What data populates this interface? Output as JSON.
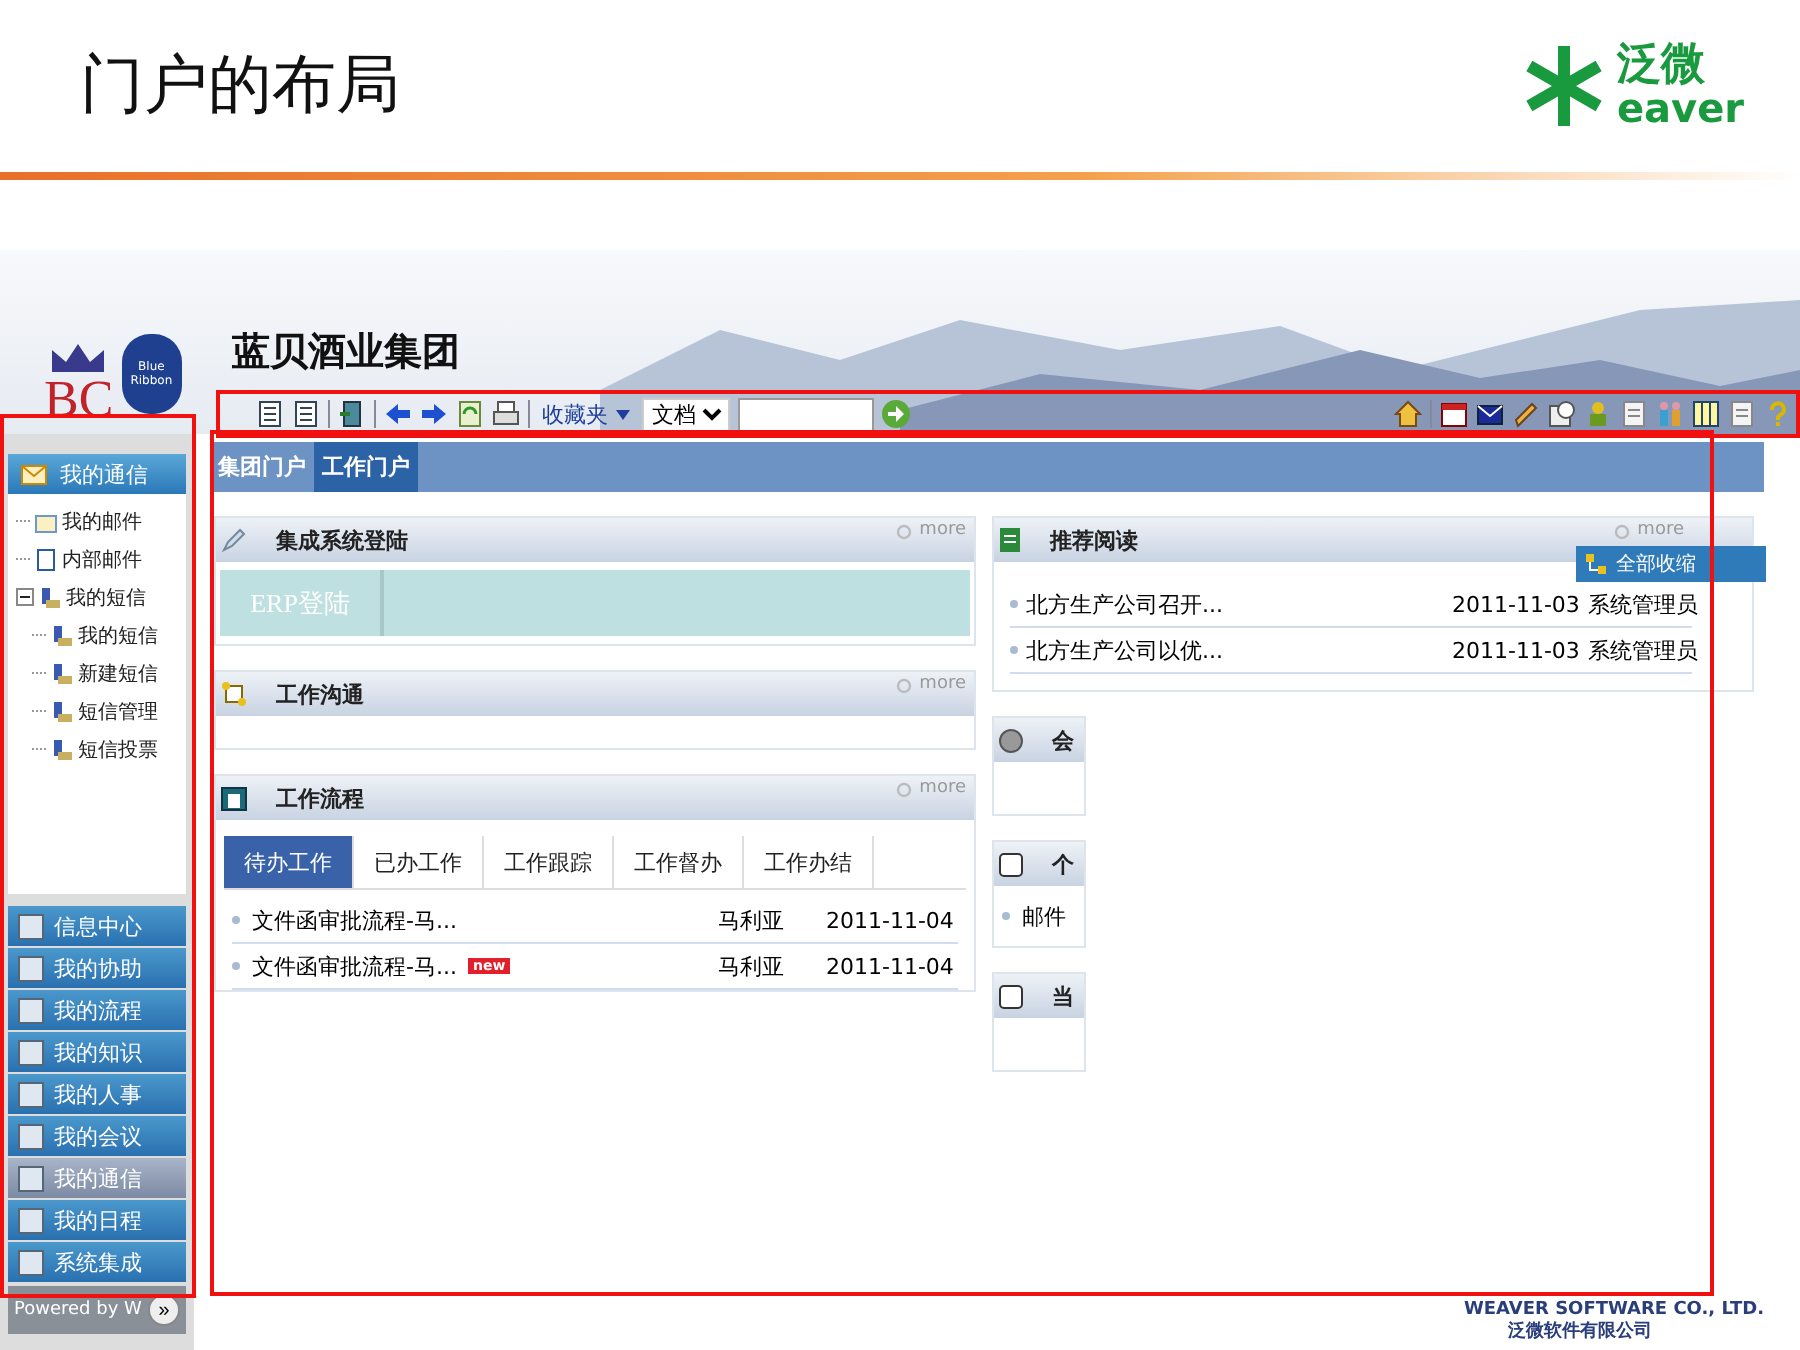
{
  "slide": {
    "title": "门户的布局",
    "logo_mark": "泛微",
    "logo_sub": "eaver"
  },
  "banner": {
    "logos": [
      "BC",
      "Blue Ribbon"
    ],
    "company": "蓝贝酒业集团"
  },
  "toolbar": {
    "favorites": "收藏夹",
    "search_type": "文档"
  },
  "sidebar": {
    "header": "我的通信",
    "tree": [
      {
        "label": "我的邮件"
      },
      {
        "label": "内部邮件"
      },
      {
        "label": "我的短信",
        "expanded": true,
        "children": [
          {
            "label": "我的短信"
          },
          {
            "label": "新建短信"
          },
          {
            "label": "短信管理"
          },
          {
            "label": "短信投票"
          }
        ]
      }
    ],
    "menu": [
      {
        "label": "信息中心",
        "selected": false
      },
      {
        "label": "我的协助",
        "selected": false
      },
      {
        "label": "我的流程",
        "selected": false
      },
      {
        "label": "我的知识",
        "selected": false
      },
      {
        "label": "我的人事",
        "selected": false
      },
      {
        "label": "我的会议",
        "selected": false
      },
      {
        "label": "我的通信",
        "selected": true
      },
      {
        "label": "我的日程",
        "selected": false
      },
      {
        "label": "系统集成",
        "selected": false
      }
    ],
    "footer": "Powered by W",
    "collapse": "»"
  },
  "portal": {
    "tabs": [
      {
        "label": "集团门户",
        "selected": false
      },
      {
        "label": "工作门户",
        "selected": true
      }
    ],
    "left_panels": [
      {
        "kind": "login",
        "title": "集成系统登陆",
        "more": "more",
        "button": "ERP登陆"
      },
      {
        "kind": "empty",
        "title": "工作沟通",
        "more": "more"
      },
      {
        "kind": "workflow",
        "title": "工作流程",
        "more": "more",
        "tabs": [
          {
            "label": "待办工作",
            "selected": true
          },
          {
            "label": "已办工作",
            "selected": false
          },
          {
            "label": "工作跟踪",
            "selected": false
          },
          {
            "label": "工作督办",
            "selected": false
          },
          {
            "label": "工作办结",
            "selected": false
          }
        ],
        "rows": [
          {
            "title": "文件函审批流程-马...",
            "author": "马利亚",
            "date": "2011-11-04",
            "new": false
          },
          {
            "title": "文件函审批流程-马...",
            "author": "马利亚",
            "date": "2011-11-04",
            "new": true
          }
        ],
        "new_label": "new"
      }
    ],
    "right_panels": [
      {
        "kind": "news",
        "title": "推荐阅读",
        "more": "more",
        "rows": [
          {
            "title": "北方生产公司召开...",
            "date": "2011-11-03",
            "author": "系统管理员"
          },
          {
            "title": "北方生产公司以优...",
            "date": "2011-11-03",
            "author": "系统管理员"
          }
        ]
      },
      {
        "kind": "clipped",
        "title": "会"
      },
      {
        "kind": "clipped",
        "title": "个",
        "rows": [
          "邮件"
        ]
      },
      {
        "kind": "clipped",
        "title": "当"
      }
    ],
    "context_menu": {
      "label": "全部收缩"
    }
  },
  "footer": {
    "english": "WEAVER SOFTWARE CO., LTD.",
    "chinese": "泛微软件有限公司"
  }
}
